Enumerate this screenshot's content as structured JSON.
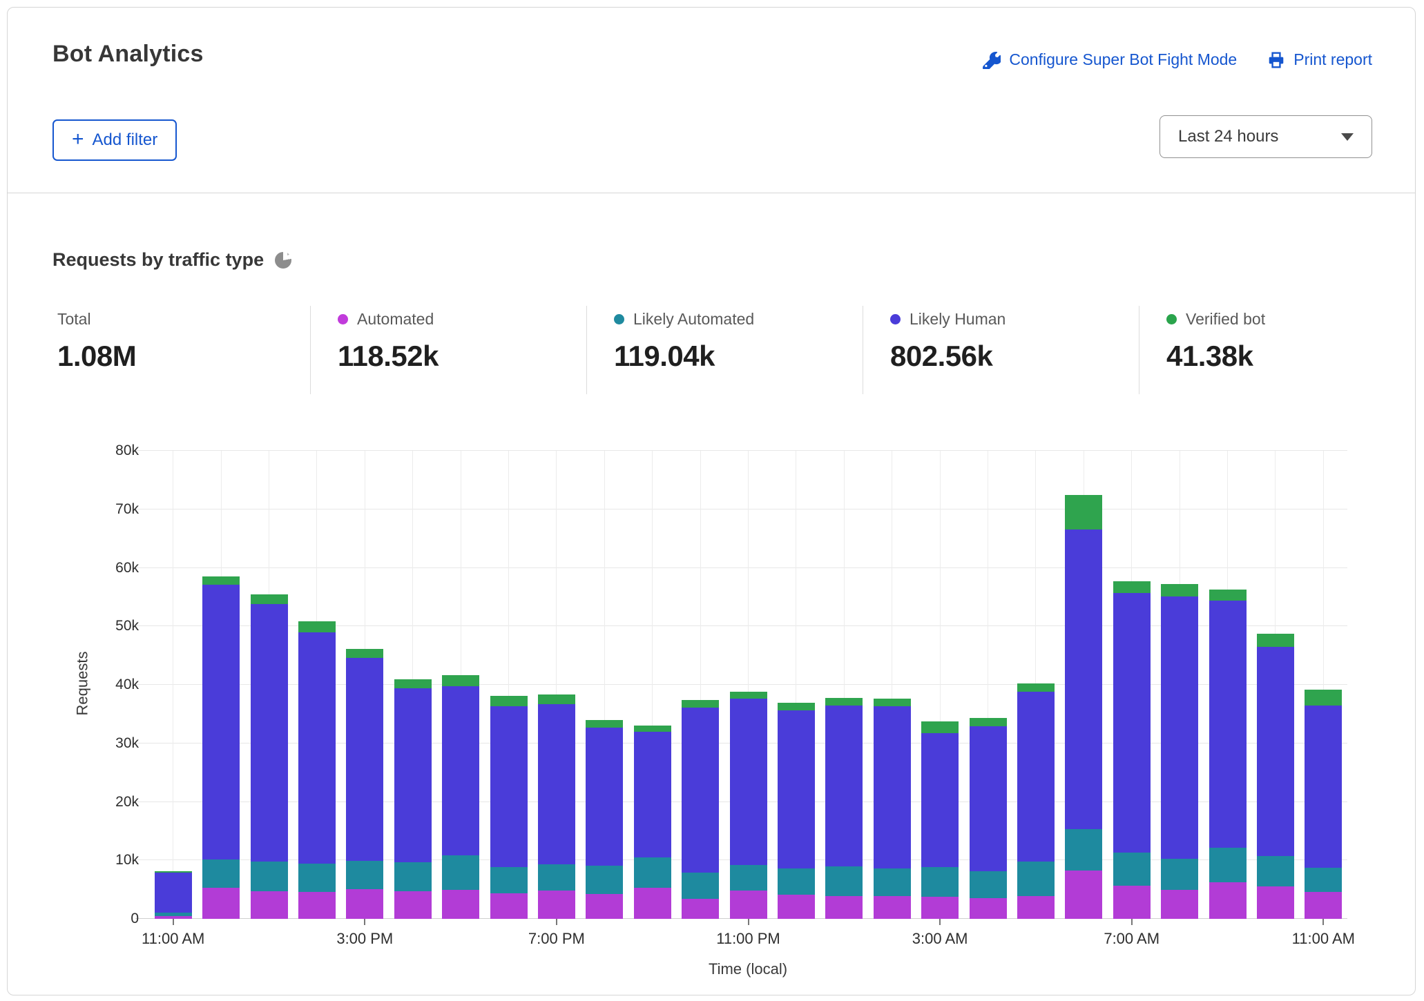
{
  "header": {
    "title": "Bot Analytics",
    "configure_link": "Configure Super Bot Fight Mode",
    "print_link": "Print report",
    "add_filter_plus": "+",
    "add_filter_label": "Add filter",
    "time_range_value": "Last 24 hours"
  },
  "section": {
    "title": "Requests by traffic type"
  },
  "stats": {
    "items": [
      {
        "label": "Total",
        "value": "1.08M",
        "color": null
      },
      {
        "label": "Automated",
        "value": "118.52k",
        "color": "#c13bdb"
      },
      {
        "label": "Likely Automated",
        "value": "119.04k",
        "color": "#1f8a9f"
      },
      {
        "label": "Likely Human",
        "value": "802.56k",
        "color": "#4a3cd9"
      },
      {
        "label": "Verified bot",
        "value": "41.38k",
        "color": "#2aa44c"
      }
    ]
  },
  "chart_data": {
    "type": "bar",
    "stacked": true,
    "title": "Requests by traffic type",
    "xlabel": "Time (local)",
    "ylabel": "Requests",
    "ylim": [
      0,
      80000
    ],
    "y_ticks": [
      "0",
      "10k",
      "20k",
      "30k",
      "40k",
      "50k",
      "60k",
      "70k",
      "80k"
    ],
    "x": [
      "11:00 AM",
      "12:00 PM",
      "1:00 PM",
      "2:00 PM",
      "3:00 PM",
      "4:00 PM",
      "5:00 PM",
      "6:00 PM",
      "7:00 PM",
      "8:00 PM",
      "9:00 PM",
      "10:00 PM",
      "11:00 PM",
      "12:00 AM",
      "1:00 AM",
      "2:00 AM",
      "3:00 AM",
      "4:00 AM",
      "5:00 AM",
      "6:00 AM",
      "7:00 AM",
      "8:00 AM",
      "9:00 AM",
      "10:00 AM",
      "11:00 AM"
    ],
    "x_tick_indices": [
      0,
      4,
      8,
      12,
      16,
      20,
      24
    ],
    "x_tick_labels": [
      "11:00 AM",
      "3:00 PM",
      "7:00 PM",
      "11:00 PM",
      "3:00 AM",
      "7:00 AM",
      "11:00 AM"
    ],
    "grid": true,
    "series": [
      {
        "name": "Automated",
        "color": "#b23cd6",
        "values": [
          500,
          5300,
          4700,
          4600,
          5100,
          4700,
          4900,
          4400,
          4800,
          4250,
          5350,
          3450,
          4850,
          4100,
          3950,
          3900,
          3800,
          3600,
          3850,
          8300,
          5700,
          5000,
          6200,
          5550,
          4600
        ]
      },
      {
        "name": "Likely Automated",
        "color": "#1e8a9f",
        "values": [
          600,
          4800,
          5100,
          4800,
          4800,
          5000,
          6000,
          4500,
          4500,
          4850,
          5150,
          4450,
          4400,
          4550,
          5050,
          4700,
          5100,
          4500,
          5950,
          7000,
          5600,
          5300,
          6000,
          5150,
          4100
        ]
      },
      {
        "name": "Likely Human",
        "color": "#4a3cd9",
        "values": [
          6800,
          47000,
          44000,
          39600,
          34700,
          29700,
          28900,
          27500,
          27400,
          23600,
          21500,
          28200,
          28350,
          26950,
          27500,
          27700,
          22900,
          24800,
          29000,
          51200,
          44450,
          44800,
          42200,
          35800,
          27800
        ]
      },
      {
        "name": "Verified bot",
        "color": "#2fa44e",
        "values": [
          200,
          1400,
          1700,
          1800,
          1500,
          1600,
          1800,
          1700,
          1700,
          1300,
          1100,
          1300,
          1200,
          1300,
          1300,
          1300,
          1900,
          1500,
          1400,
          5900,
          1950,
          2100,
          1900,
          2200,
          2700
        ]
      }
    ]
  }
}
